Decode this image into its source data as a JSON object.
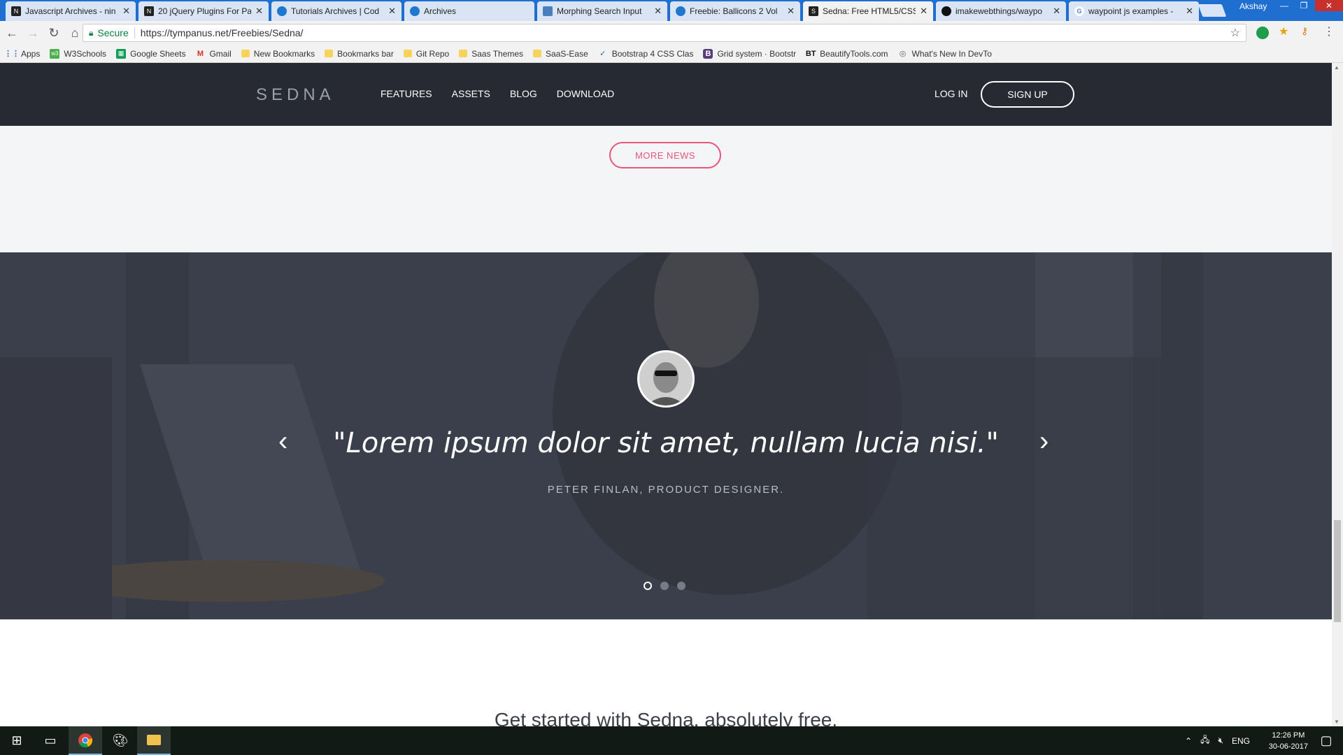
{
  "browser": {
    "tabs": [
      {
        "title": "Javascript Archives - nin",
        "icon": "ninja-icon",
        "active": false
      },
      {
        "title": "20 jQuery Plugins For Pa",
        "icon": "ninja-icon",
        "active": false
      },
      {
        "title": "Tutorials Archives | Cod",
        "icon": "codrops-icon",
        "active": false
      },
      {
        "title": "Archives",
        "icon": "codrops-icon",
        "active": false
      },
      {
        "title": "Morphing Search Input",
        "icon": "document-icon",
        "active": false
      },
      {
        "title": "Freebie: Ballicons 2 Vol",
        "icon": "codrops-icon",
        "active": false
      },
      {
        "title": "Sedna: Free HTML5/CSS",
        "icon": "sedna-icon",
        "active": true
      },
      {
        "title": "imakewebthings/waypo",
        "icon": "github-icon",
        "active": false
      },
      {
        "title": "waypoint js examples -",
        "icon": "google-icon",
        "active": false
      }
    ],
    "profile_name": "Akshay",
    "secure_label": "Secure",
    "url": "https://tympanus.net/Freebies/Sedna/"
  },
  "bookmarks": [
    {
      "label": "Apps",
      "icon": "apps-icon"
    },
    {
      "label": "W3Schools",
      "icon": "w3schools-icon"
    },
    {
      "label": "Google Sheets",
      "icon": "sheets-icon"
    },
    {
      "label": "Gmail",
      "icon": "gmail-icon"
    },
    {
      "label": "New Bookmarks",
      "icon": "folder-icon"
    },
    {
      "label": "Bookmarks bar",
      "icon": "folder-icon"
    },
    {
      "label": "Git Repo",
      "icon": "folder-icon"
    },
    {
      "label": "Saas Themes",
      "icon": "folder-icon"
    },
    {
      "label": "SaaS-Ease",
      "icon": "folder-icon"
    },
    {
      "label": "Bootstrap 4 CSS Clas",
      "icon": "cdn-icon"
    },
    {
      "label": "Grid system · Bootstr",
      "icon": "bootstrap-icon"
    },
    {
      "label": "BeautifyTools.com",
      "icon": "beautify-icon"
    },
    {
      "label": "What's New In DevTo",
      "icon": "devtools-icon"
    }
  ],
  "site": {
    "logo": "SEDNA",
    "nav": [
      "FEATURES",
      "ASSETS",
      "BLOG",
      "DOWNLOAD"
    ],
    "login": "LOG IN",
    "signup": "SIGN UP",
    "more_news": "MORE NEWS",
    "testimonial": {
      "quote": "\"Lorem ipsum dolor sit amet, nullam lucia nisi.\"",
      "author": "PETER FINLAN, PRODUCT DESIGNER.",
      "slide_count": 3,
      "active_slide": 1
    },
    "cta": "Get started with Sedna, absolutely free."
  },
  "taskbar": {
    "language": "ENG",
    "time": "12:26 PM",
    "date": "30-06-2017"
  },
  "colors": {
    "nav_bg": "#272a33",
    "accent_pink": "#e8567a",
    "tab_strip": "#1f6fd1"
  }
}
